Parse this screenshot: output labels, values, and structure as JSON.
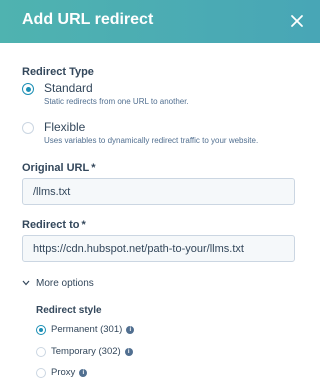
{
  "header": {
    "title": "Add URL redirect",
    "close_icon": "close-icon"
  },
  "redirect_type": {
    "label": "Redirect Type",
    "options": [
      {
        "label": "Standard",
        "description": "Static redirects from one URL to another.",
        "selected": true
      },
      {
        "label": "Flexible",
        "description": "Uses variables to dynamically redirect traffic to your website.",
        "selected": false
      }
    ]
  },
  "original_url": {
    "label": "Original URL",
    "required_mark": "*",
    "value": "/llms.txt"
  },
  "redirect_to": {
    "label": "Redirect to",
    "required_mark": "*",
    "value": "https://cdn.hubspot.net/path-to-your/llms.txt"
  },
  "more_options": {
    "label": "More options"
  },
  "redirect_style": {
    "label": "Redirect style",
    "options": [
      {
        "label": "Permanent (301)",
        "selected": true
      },
      {
        "label": "Temporary (302)",
        "selected": false
      },
      {
        "label": "Proxy",
        "selected": false
      }
    ]
  },
  "colors": {
    "header_start": "#4fb3b0",
    "header_end": "#48a6b6",
    "accent": "#1c8fb5",
    "text": "#33475b"
  }
}
